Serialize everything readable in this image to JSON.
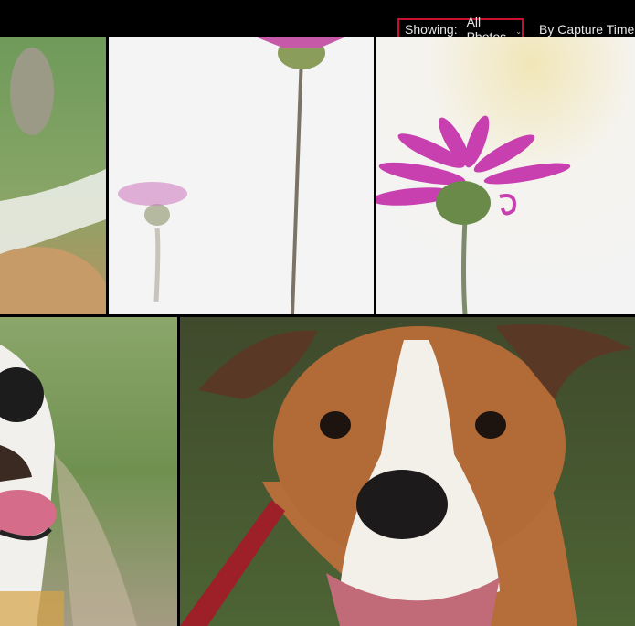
{
  "toolbar": {
    "filter_label": "Showing:",
    "filter_value": "All Photos",
    "sort_label": "By Capture Time",
    "accent_color": "#c8102e"
  },
  "photos": [
    {
      "subject": "dog-ear-and-rope",
      "icon": "photo-thumbnail"
    },
    {
      "subject": "pink-daisy-tall-stem",
      "icon": "photo-thumbnail"
    },
    {
      "subject": "pink-daisy-closeup",
      "icon": "photo-thumbnail"
    },
    {
      "subject": "dog-tongue-out",
      "icon": "photo-thumbnail"
    },
    {
      "subject": "dog-portrait-red-leash",
      "icon": "photo-thumbnail"
    }
  ]
}
